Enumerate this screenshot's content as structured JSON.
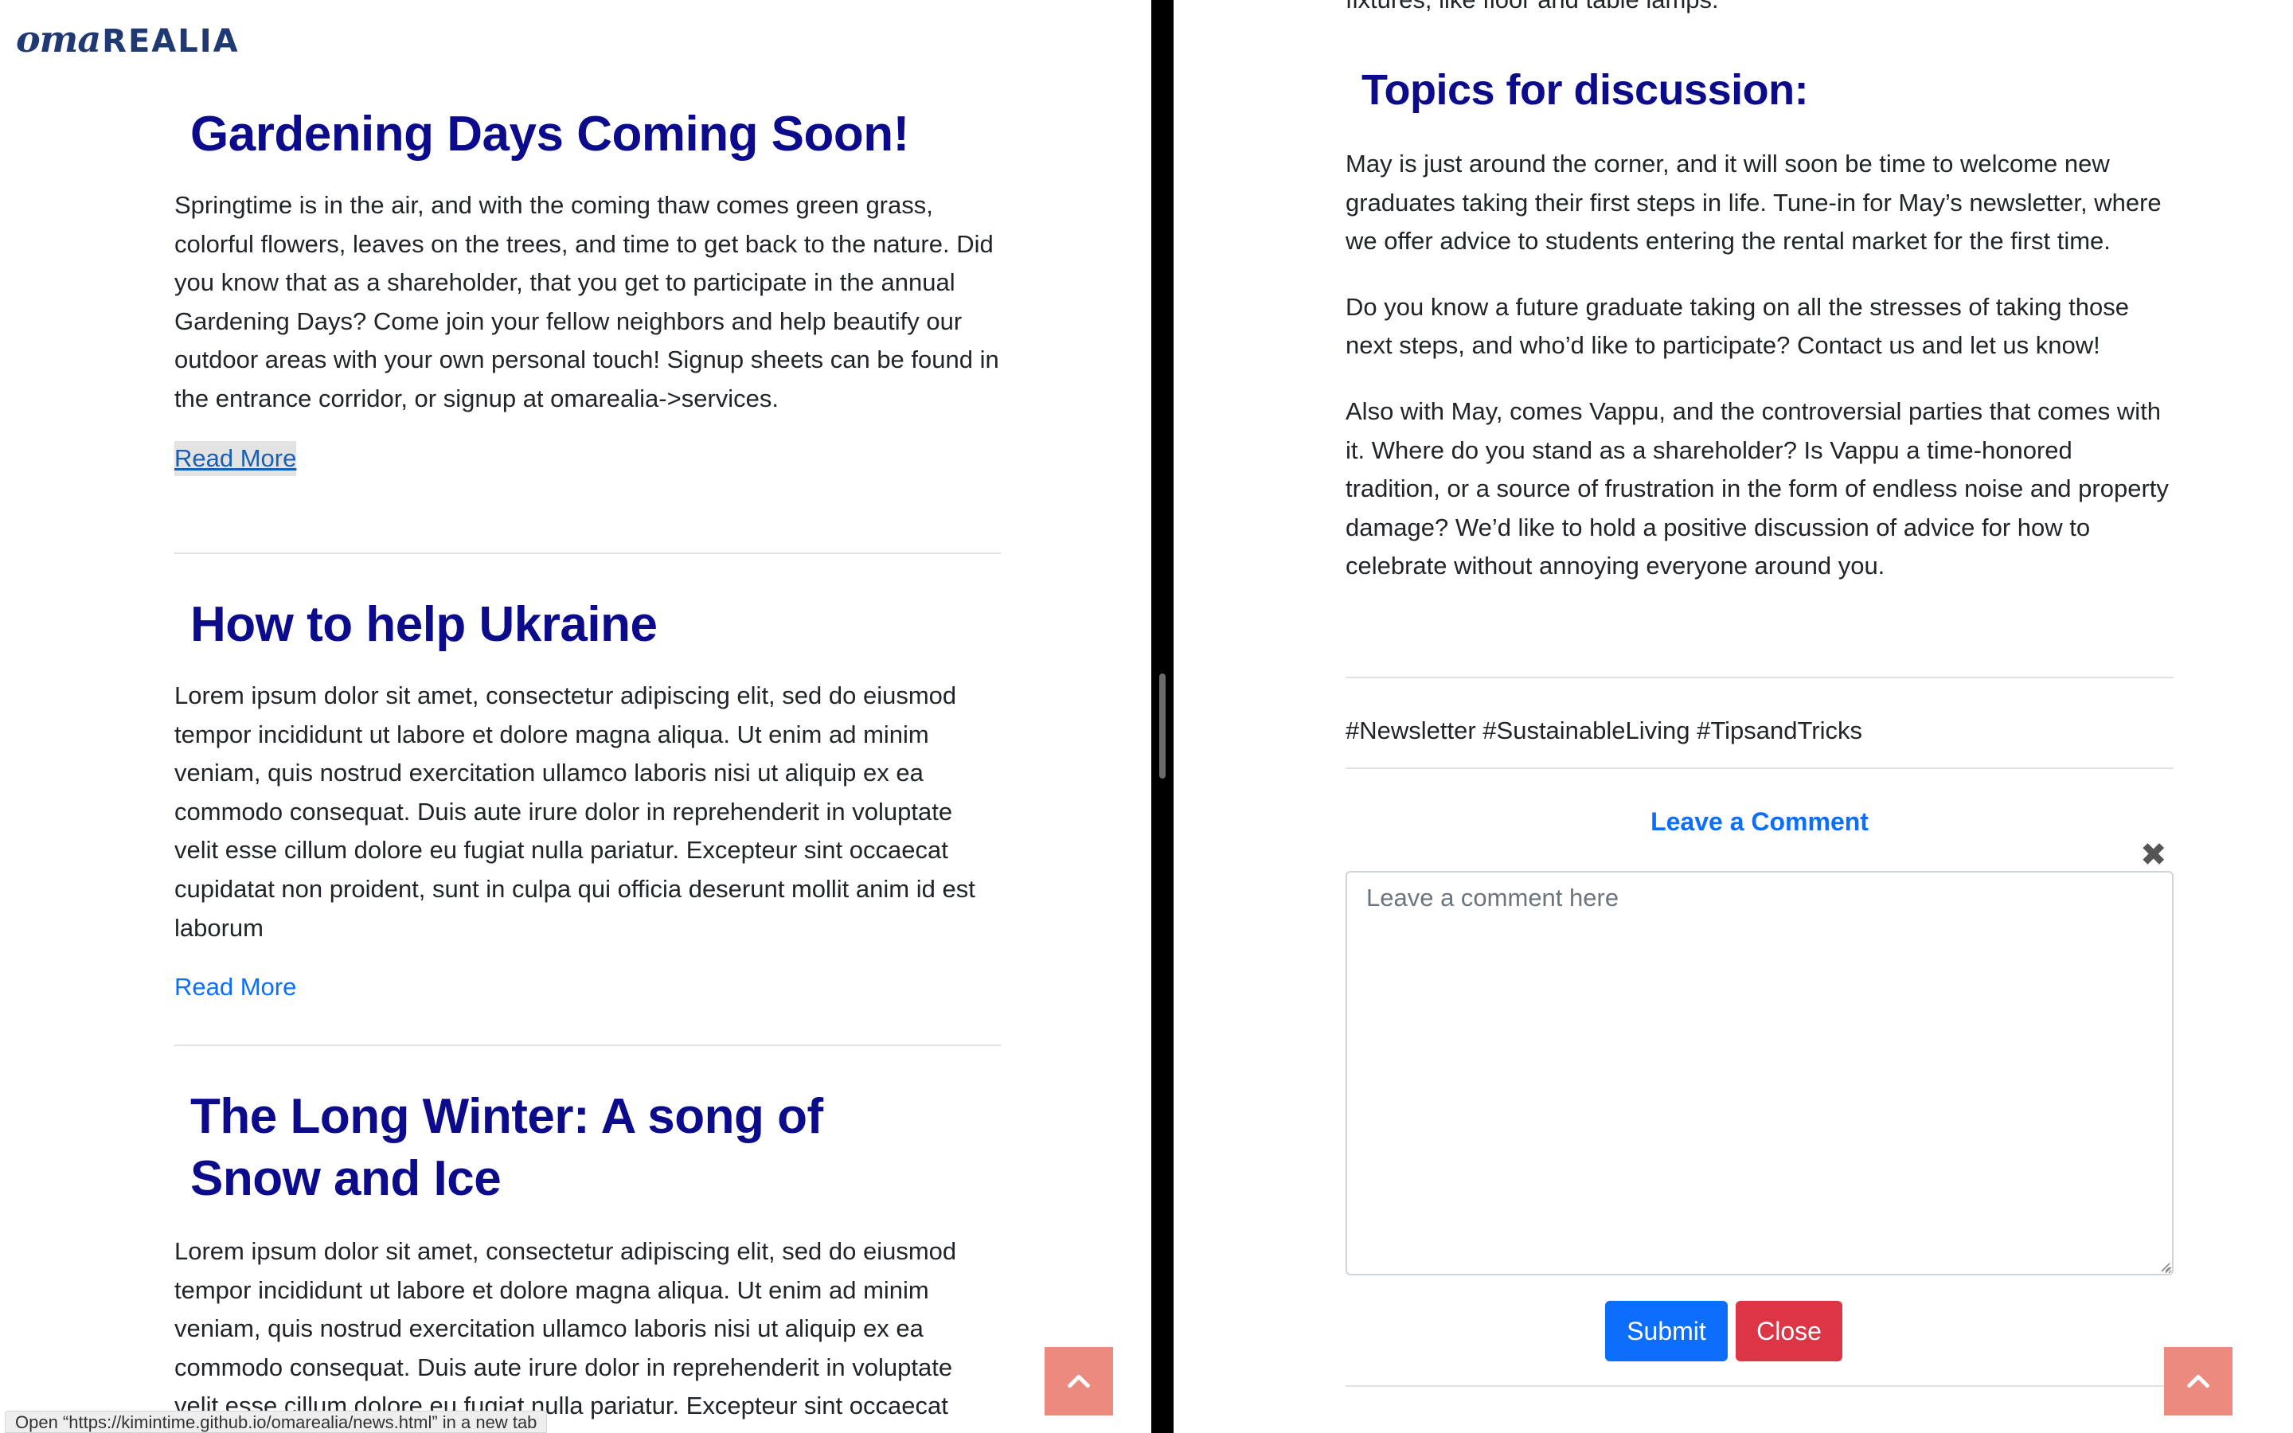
{
  "logo": {
    "script": "oma",
    "caps": "REALIA"
  },
  "left": {
    "articles": [
      {
        "title": "Gardening Days Coming Soon!",
        "body": "Springtime is in the air, and with the coming thaw comes green grass, colorful flowers, leaves on the trees, and time to get back to the nature. Did you know that as a shareholder, that you get to participate in the annual Gardening Days? Come join your fellow neighbors and help beautify our outdoor areas with your own personal touch! Signup sheets can be found in the entrance corridor, or signup at omarealia->services.",
        "read_more": "Read More"
      },
      {
        "title": "How to help Ukraine",
        "body": "Lorem ipsum dolor sit amet, consectetur adipiscing elit, sed do eiusmod tempor incididunt ut labore et dolore magna aliqua. Ut enim ad minim veniam, quis nostrud exercitation ullamco laboris nisi ut aliquip ex ea commodo consequat. Duis aute irure dolor in reprehenderit in voluptate velit esse cillum dolore eu fugiat nulla pariatur. Excepteur sint occaecat cupidatat non proident, sunt in culpa qui officia deserunt mollit anim id est laborum",
        "read_more": "Read More"
      },
      {
        "title": "The Long Winter: A song of Snow and Ice",
        "body": "Lorem ipsum dolor sit amet, consectetur adipiscing elit, sed do eiusmod tempor incididunt ut labore et dolore magna aliqua. Ut enim ad minim veniam, quis nostrud exercitation ullamco laboris nisi ut aliquip ex ea commodo consequat. Duis aute irure dolor in reprehenderit in voluptate velit esse cillum dolore eu fugiat nulla pariatur. Excepteur sint occaecat cupidatat non proident, sunt in culpa qui officia deserunt mollit anim id est laborum"
      }
    ],
    "status_bar": "Open “https://kimintime.github.io/omarealia/news.html” in a new tab"
  },
  "right": {
    "top_cut": "fixtures, like floor and table lamps.",
    "heading": "Topics for discussion:",
    "paragraphs": [
      "May is just around the corner, and it will soon be time to welcome new graduates taking their first steps in life. Tune-in for May’s newsletter, where we offer advice to students entering the rental market for the first time.",
      "Do you know a future graduate taking on all the stresses of taking those next steps, and who’d like to participate? Contact us and let us know!",
      "Also with May, comes Vappu, and the controversial parties that comes with it. Where do you stand as a shareholder? Is Vappu a time-honored tradition, or a source of frustration in the form of endless noise and property damage? We’d like to hold a positive discussion of advice for how to celebrate without annoying everyone around you."
    ],
    "tags": "#Newsletter #SustainableLiving #TipsandTricks",
    "leave_comment": "Leave a Comment",
    "close_icon": "✖",
    "comment_placeholder": "Leave a comment here",
    "submit": "Submit",
    "close": "Close"
  },
  "colors": {
    "heading": "#0b0b8c",
    "link": "#0d6efd",
    "scroll_top": "#ec8a7f",
    "submit": "#0d6efd",
    "close": "#dc3545"
  },
  "icons": [
    "chevron-up-icon",
    "close-icon",
    "resize-grip-icon"
  ]
}
